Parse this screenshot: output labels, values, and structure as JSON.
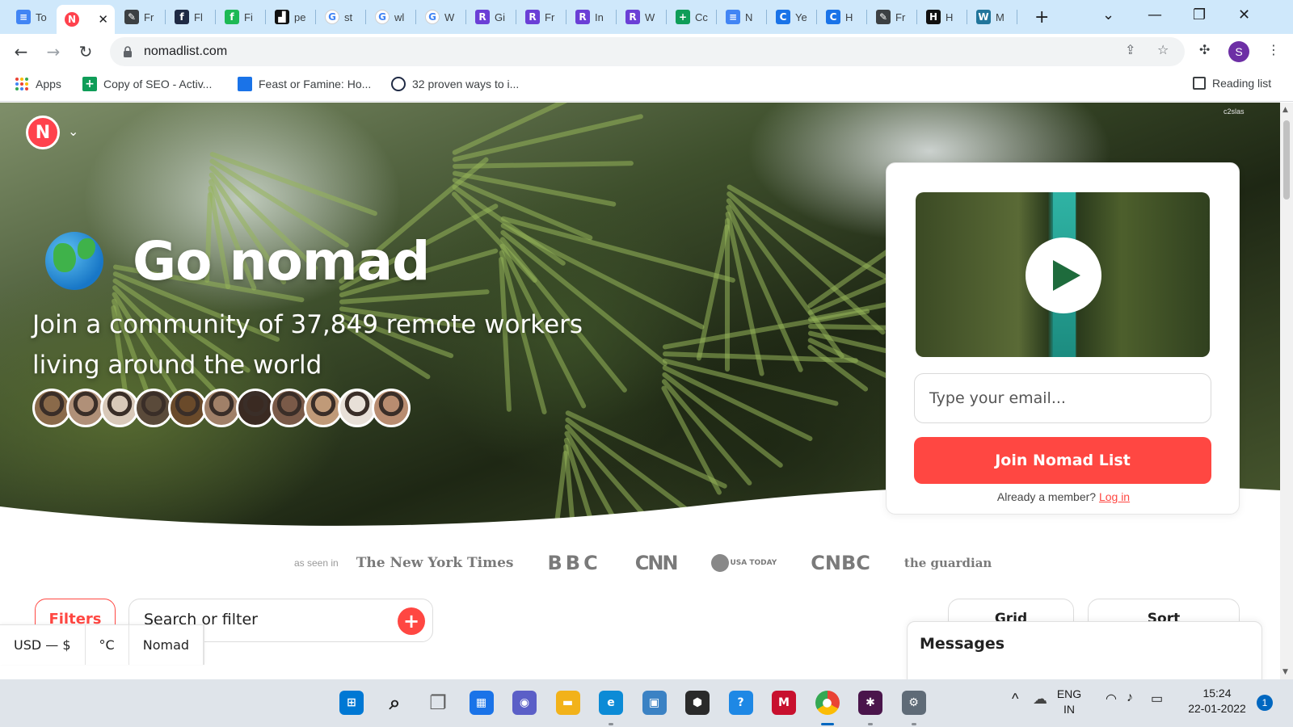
{
  "browser": {
    "tabs": [
      {
        "title": "To",
        "favicon": "google-docs-icon",
        "color": "#4285f4",
        "glyph": "≡"
      },
      {
        "title": "",
        "favicon": "nomadlist-icon",
        "color": "#ff424d",
        "glyph": "N",
        "active": true
      },
      {
        "title": "Fr",
        "favicon": "document-edit-icon",
        "color": "#3c4043",
        "glyph": "✎"
      },
      {
        "title": "Fl",
        "favicon": "flipboard-icon",
        "color": "#1f2a44",
        "glyph": "f"
      },
      {
        "title": "Fi",
        "favicon": "fi-icon",
        "color": "#1db954",
        "glyph": "f"
      },
      {
        "title": "pe",
        "favicon": "pe-icon",
        "color": "#111111",
        "glyph": "▟"
      },
      {
        "title": "st",
        "favicon": "google-icon",
        "color": "#ffffff",
        "glyph": "G"
      },
      {
        "title": "wl",
        "favicon": "google-icon",
        "color": "#ffffff",
        "glyph": "G"
      },
      {
        "title": "W",
        "favicon": "google-icon",
        "color": "#ffffff",
        "glyph": "G"
      },
      {
        "title": "Gi",
        "favicon": "rytr-icon",
        "color": "#6b3fd6",
        "glyph": "R"
      },
      {
        "title": "Fr",
        "favicon": "rytr-icon",
        "color": "#6b3fd6",
        "glyph": "R"
      },
      {
        "title": "In",
        "favicon": "rytr-icon",
        "color": "#6b3fd6",
        "glyph": "R"
      },
      {
        "title": "W",
        "favicon": "rytr-icon",
        "color": "#6b3fd6",
        "glyph": "R"
      },
      {
        "title": "Cc",
        "favicon": "google-sheets-icon",
        "color": "#0f9d58",
        "glyph": "+"
      },
      {
        "title": "N",
        "favicon": "google-docs-icon",
        "color": "#4285f4",
        "glyph": "≡"
      },
      {
        "title": "Ye",
        "favicon": "c-icon",
        "color": "#1a73e8",
        "glyph": "C"
      },
      {
        "title": "H",
        "favicon": "c-icon",
        "color": "#1a73e8",
        "glyph": "C"
      },
      {
        "title": "Fr",
        "favicon": "document-edit-icon",
        "color": "#3c4043",
        "glyph": "✎"
      },
      {
        "title": "H",
        "favicon": "h-icon",
        "color": "#111111",
        "glyph": "H"
      },
      {
        "title": "M",
        "favicon": "wordpress-icon",
        "color": "#21759b",
        "glyph": "W"
      }
    ],
    "new_tab": "+",
    "url": "nomadlist.com",
    "profile_initial": "S",
    "bookmarks": [
      {
        "label": "Apps",
        "icon": "apps-grid-icon"
      },
      {
        "label": "Copy of SEO - Activ...",
        "icon": "google-sheets-icon"
      },
      {
        "label": "Feast or Famine: Ho...",
        "icon": "figure-icon"
      },
      {
        "label": "32 proven ways to i...",
        "icon": "circle-icon"
      }
    ],
    "reading_list": "Reading list"
  },
  "page": {
    "photo_credit": "c2slas",
    "hero_title": "Go nomad",
    "hero_subtitle": "Join a community of 37,849 remote workers living around the world",
    "avatar_colors": [
      "#8a6a4a",
      "#b09078",
      "#d8c8b8",
      "#5a4a3a",
      "#6a4a2a",
      "#a08068",
      "#3a2a22",
      "#7a5a48",
      "#c09a78",
      "#e8e0d8",
      "#b88c70"
    ],
    "signup": {
      "email_placeholder": "Type your email...",
      "join_button": "Join Nomad List",
      "member_text": "Already a member?",
      "login_link": "Log in"
    },
    "press": {
      "label": "as seen in",
      "logos": [
        "The New York Times",
        "BBC",
        "CNN",
        "USA TODAY",
        "CNBC",
        "the guardian"
      ]
    },
    "filters_button": "Filters",
    "search_placeholder": "Search or filter",
    "grid_button": "Grid",
    "sort_button": "Sort",
    "units": [
      "USD — $",
      "°C",
      "Nomad"
    ],
    "messages": "Messages"
  },
  "taskbar": {
    "icons": [
      "windows-start-icon",
      "search-icon",
      "task-view-icon",
      "widgets-icon",
      "teams-chat-icon",
      "file-explorer-icon",
      "edge-icon",
      "store-icon",
      "app-icon",
      "help-icon",
      "mcafee-icon",
      "chrome-icon",
      "slack-icon",
      "settings-icon"
    ],
    "language": "ENG",
    "region": "IN",
    "time": "15:24",
    "date": "22-01-2022",
    "notification_count": "1"
  }
}
